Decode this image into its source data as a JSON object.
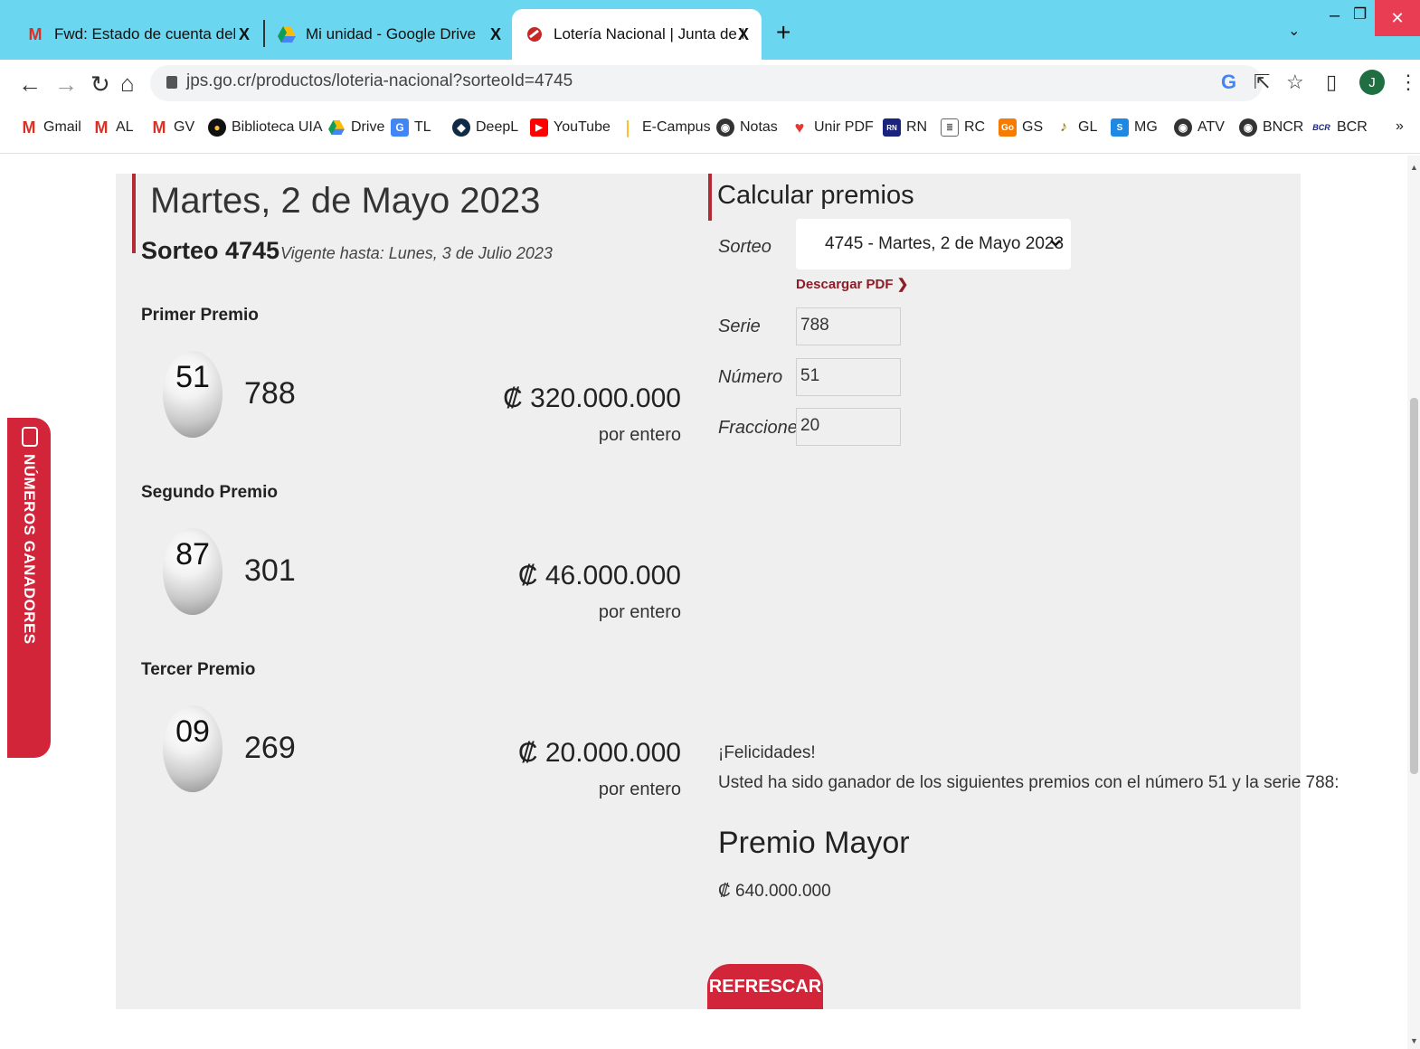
{
  "browser": {
    "tabs": [
      {
        "title": "Fwd: Estado de cuenta del Banco",
        "icon": "gmail-icon",
        "close": "X"
      },
      {
        "title": "Mi unidad - Google Drive",
        "icon": "drive-icon",
        "close": "X"
      },
      {
        "title": "Lotería Nacional | Junta de Protec",
        "icon": "jps-icon",
        "close": "X"
      }
    ],
    "new_tab": "+",
    "url": "jps.go.cr/productos/loteria-nacional?sorteoId=4745",
    "avatar_letter": "J",
    "bookmarks": [
      "Gmail",
      "AL",
      "GV",
      "Biblioteca UIA",
      "Drive",
      "TL",
      "DeepL",
      "YouTube",
      "E-Campus",
      "Notas",
      "Unir PDF",
      "RN",
      "RC",
      "GS",
      "GL",
      "MG",
      "ATV",
      "BNCR",
      "BCR"
    ],
    "bookmarks_more": "»"
  },
  "draw": {
    "date_title": "Martes, 2 de Mayo 2023",
    "sorteo": "Sorteo 4745",
    "vigente": "Vigente hasta: Lunes, 3 de Julio 2023",
    "prizes": [
      {
        "label": "Primer Premio",
        "numero": "51",
        "serie": "788",
        "amount": "₡ 320.000.000",
        "unit": "por entero"
      },
      {
        "label": "Segundo Premio",
        "numero": "87",
        "serie": "301",
        "amount": "₡ 46.000.000",
        "unit": "por entero"
      },
      {
        "label": "Tercer Premio",
        "numero": "09",
        "serie": "269",
        "amount": "₡ 20.000.000",
        "unit": "por entero"
      }
    ]
  },
  "calculator": {
    "title": "Calcular premios",
    "sorteo_label": "Sorteo",
    "sorteo_value": "4745 - Martes, 2 de Mayo 2023",
    "pdf_link": "Descargar PDF ❯",
    "serie_label": "Serie",
    "serie_value": "788",
    "numero_label": "Número",
    "numero_value": "51",
    "fracciones_label": "Fracciones",
    "fracciones_value": "20",
    "felicidades": "¡Felicidades!",
    "ganador_text": "Usted ha sido ganador de los siguientes premios con el número 51 y la serie 788:",
    "premio_title": "Premio Mayor",
    "premio_monto": "₡ 640.000.000",
    "refrescar": "REFRESCAR"
  },
  "side_tab": "NÚMEROS GANADORES",
  "colors": {
    "accent_red": "#d2253a",
    "dark_red": "#b12a35",
    "tab_bar": "#6ad6ef"
  }
}
